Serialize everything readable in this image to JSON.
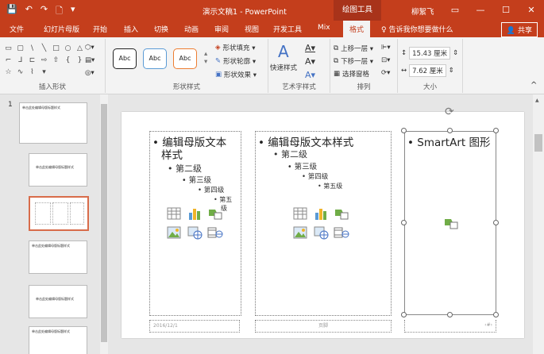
{
  "titlebar": {
    "title": "演示文稿1 - PowerPoint",
    "context_tab": "绘图工具",
    "user": "柳絮飞",
    "qat": [
      "💾",
      "↶",
      "↷",
      "🗋",
      "▾"
    ],
    "win_buttons": [
      "▭",
      "—",
      "☐",
      "✕"
    ]
  },
  "tabs": {
    "items": [
      "文件",
      "幻灯片母版",
      "开始",
      "插入",
      "切换",
      "动画",
      "审阅",
      "视图",
      "开发工具",
      "Mix",
      "格式"
    ],
    "active": "格式",
    "tell_me": "♀ 告诉我你想要做什么",
    "share": "👤 共享"
  },
  "ribbon": {
    "insert_shapes_label": "插入形状",
    "shape_styles_label": "形状样式",
    "style_box_text": "Abc",
    "shape_fill": "形状填充 ▾",
    "shape_outline": "形状轮廓 ▾",
    "shape_effects": "形状效果 ▾",
    "quick_styles": "快速样式",
    "wordart_label": "艺术字样式",
    "bring_forward": "上移一层 ▾",
    "send_backward": "下移一层 ▾",
    "selection_pane": "选择窗格",
    "arrange_label": "排列",
    "height": "15.43 厘米",
    "width": "7.62 厘米",
    "size_label": "大小"
  },
  "thumbnails": [
    {
      "num": "1",
      "title": "单击此处编辑母版标题样式"
    },
    {
      "num": "",
      "title": "单击此处编辑母版标题样式"
    },
    {
      "num": "",
      "title": ""
    },
    {
      "num": "",
      "title": "单击此处编辑母版标题样式"
    },
    {
      "num": "",
      "title": "单击此处编辑母版标题样式"
    },
    {
      "num": "",
      "title": "单击此处编辑母版标题样式"
    }
  ],
  "slide": {
    "col1": {
      "l1": "编辑母版文本",
      "l1b": "样式",
      "l2": "第二级",
      "l3": "第三级",
      "l4": "第四级",
      "l5": "第五",
      "l5b": "级"
    },
    "col2": {
      "l1": "编辑母版文本样式",
      "l2": "第二级",
      "l3": "第三级",
      "l4": "第四级",
      "l5": "第五级"
    },
    "col3": {
      "l1": "SmartArt 图形"
    },
    "footer_date": "2016/12/1",
    "footer_text": "页脚",
    "footer_num": "‹#›"
  },
  "colors": {
    "accent": "#c43e1c"
  }
}
